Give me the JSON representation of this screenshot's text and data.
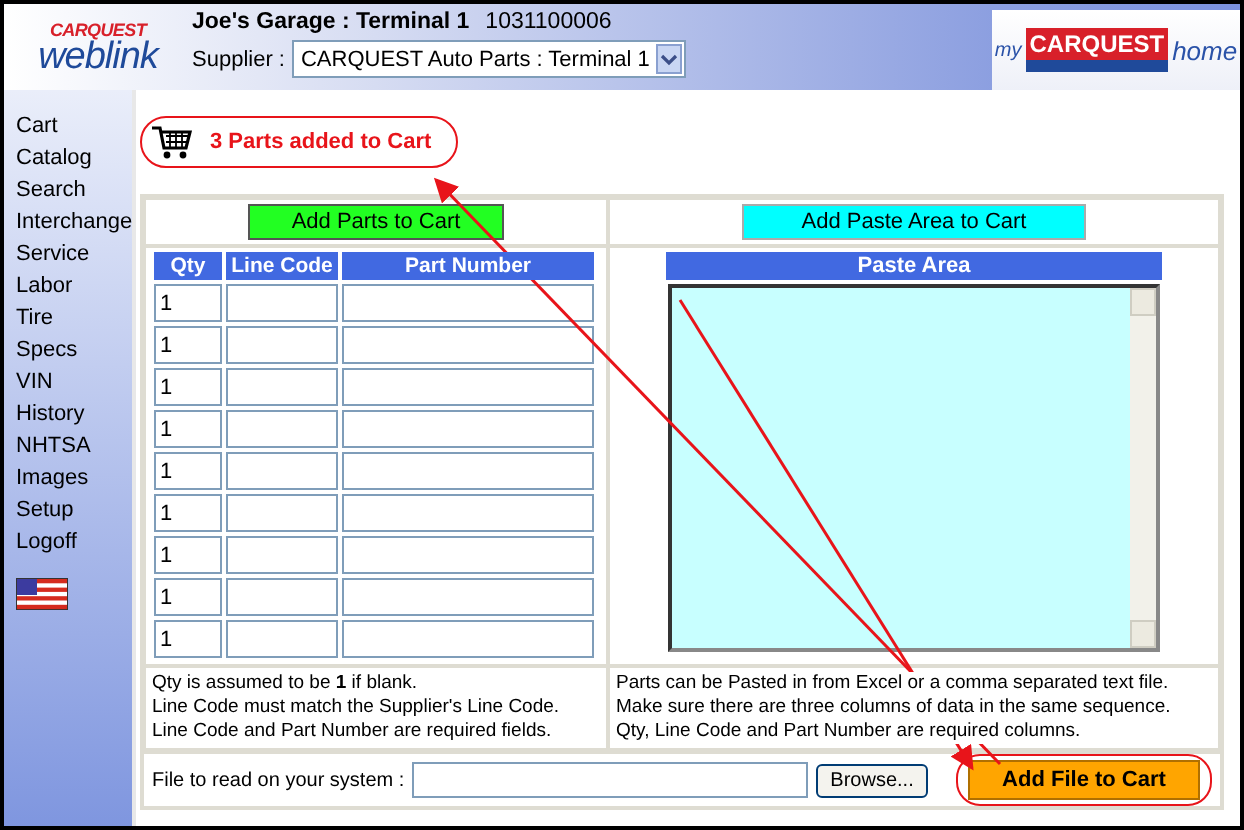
{
  "header": {
    "logo": {
      "brand": "CARQUEST",
      "product": "weblink"
    },
    "account": "Joe's Garage : Terminal 1",
    "account_number": "1031100006",
    "supplier_label": "Supplier :",
    "supplier": "CARQUEST Auto Parts : Terminal 1",
    "home_logo": {
      "prefix": "my",
      "brand": "CARQUEST",
      "suffix": "home"
    }
  },
  "sidebar": {
    "items": [
      "Cart",
      "Catalog",
      "Search",
      "Interchange",
      "Service",
      "Labor",
      "Tire",
      "Specs",
      "VIN",
      "History",
      "NHTSA",
      "Images",
      "Setup",
      "Logoff"
    ]
  },
  "message": "3 Parts added to Cart",
  "parts_entry": {
    "button": "Add Parts to Cart",
    "columns": [
      "Qty",
      "Line Code",
      "Part Number"
    ],
    "rows": [
      {
        "qty": "1"
      },
      {
        "qty": "1"
      },
      {
        "qty": "1"
      },
      {
        "qty": "1"
      },
      {
        "qty": "1"
      },
      {
        "qty": "1"
      },
      {
        "qty": "1"
      },
      {
        "qty": "1"
      },
      {
        "qty": "1"
      }
    ],
    "notes": [
      "Qty is assumed to be **1** if blank.",
      "Line Code must match the Supplier's Line Code.",
      "Line Code and Part Number are required fields."
    ]
  },
  "paste": {
    "button": "Add Paste Area to Cart",
    "heading": "Paste Area",
    "notes": [
      "Parts can be Pasted in from Excel or a comma separated text file.",
      "Make sure there are three columns of data in the same sequence.",
      "Qty, Line Code and Part Number are required columns."
    ]
  },
  "file": {
    "label": "File to read on your system :",
    "browse": "Browse...",
    "button": "Add File to Cart"
  }
}
